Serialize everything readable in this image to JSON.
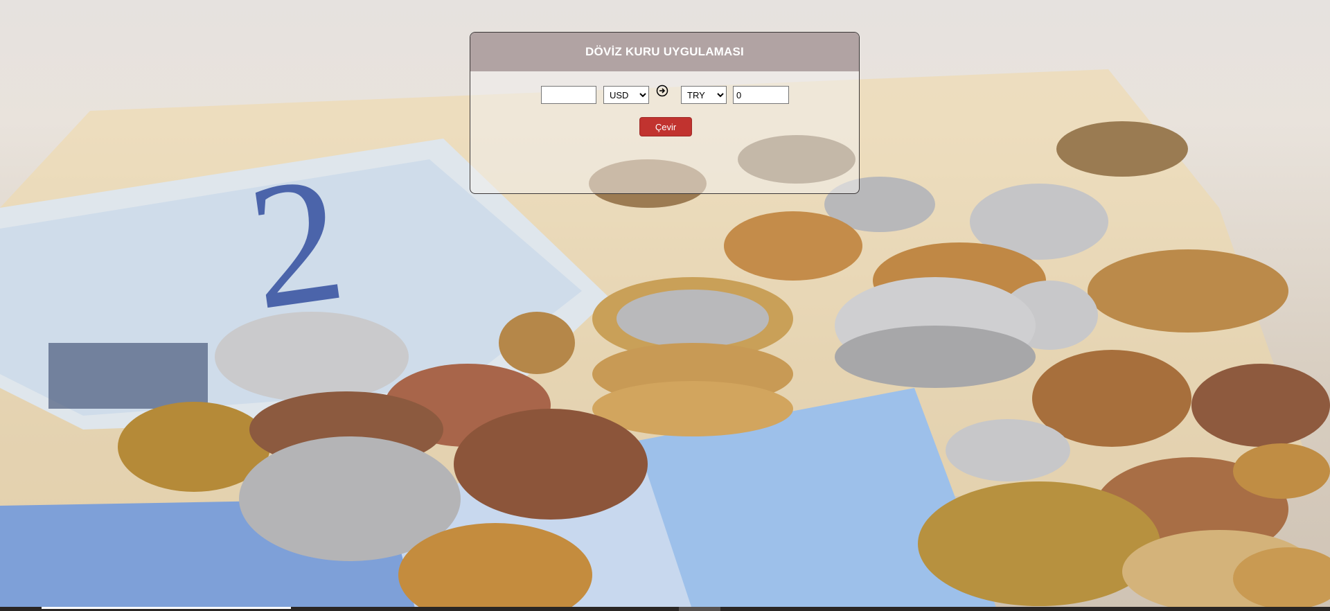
{
  "page": {
    "background_description_icon": "coins-and-banknotes-photo"
  },
  "panel": {
    "title": "DÖVİZ KURU UYGULAMASI",
    "amount_input": {
      "value": "",
      "placeholder": ""
    },
    "from_currency": {
      "selected": "USD",
      "options": [
        "USD"
      ]
    },
    "swap_icon": "arrow-circle-right-icon",
    "to_currency": {
      "selected": "TRY",
      "options": [
        "TRY"
      ]
    },
    "result_input": {
      "value": "0"
    },
    "convert_button_label": "Çevir"
  },
  "colors": {
    "header_bg": "#b1a3a3",
    "button_bg": "#c1332f",
    "button_text": "#ffffff",
    "header_text": "#ffffff"
  }
}
